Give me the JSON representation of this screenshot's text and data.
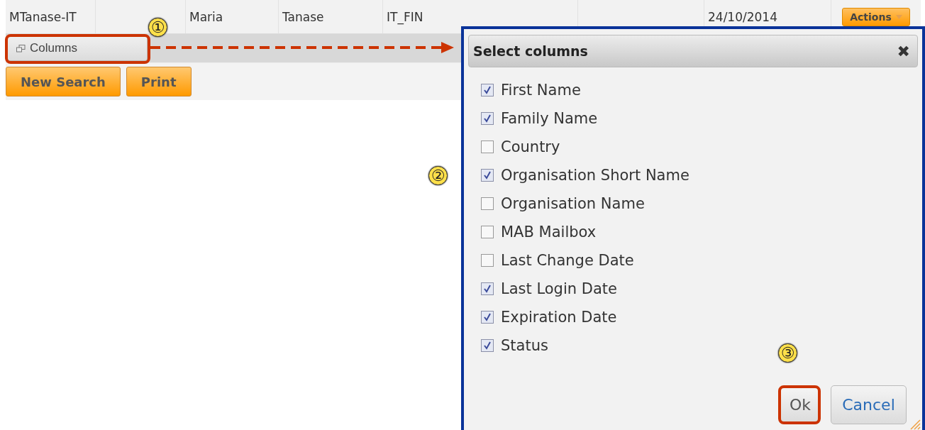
{
  "table": {
    "row": {
      "column_1": "MTanase-IT",
      "column_3": "Maria",
      "column_4": "Tanase",
      "column_5": "IT_FIN",
      "column_7": "24/10/2014"
    },
    "actions_button": "Actions"
  },
  "columns_button": "Columns",
  "buttons": [
    "New Search",
    "Print"
  ],
  "dialog": {
    "title": "Select columns",
    "close": "✖",
    "items": [
      {
        "label": "First Name",
        "checked": true
      },
      {
        "label": "Family Name",
        "checked": true
      },
      {
        "label": "Country",
        "checked": false
      },
      {
        "label": "Organisation Short Name",
        "checked": true
      },
      {
        "label": "Organisation Name",
        "checked": false
      },
      {
        "label": "MAB Mailbox",
        "checked": false
      },
      {
        "label": "Last Change Date",
        "checked": false
      },
      {
        "label": "Last Login Date",
        "checked": true
      },
      {
        "label": "Expiration Date",
        "checked": true
      },
      {
        "label": "Status",
        "checked": true
      }
    ],
    "ok": "Ok",
    "cancel": "Cancel"
  },
  "markers": [
    "①",
    "②",
    "③"
  ]
}
